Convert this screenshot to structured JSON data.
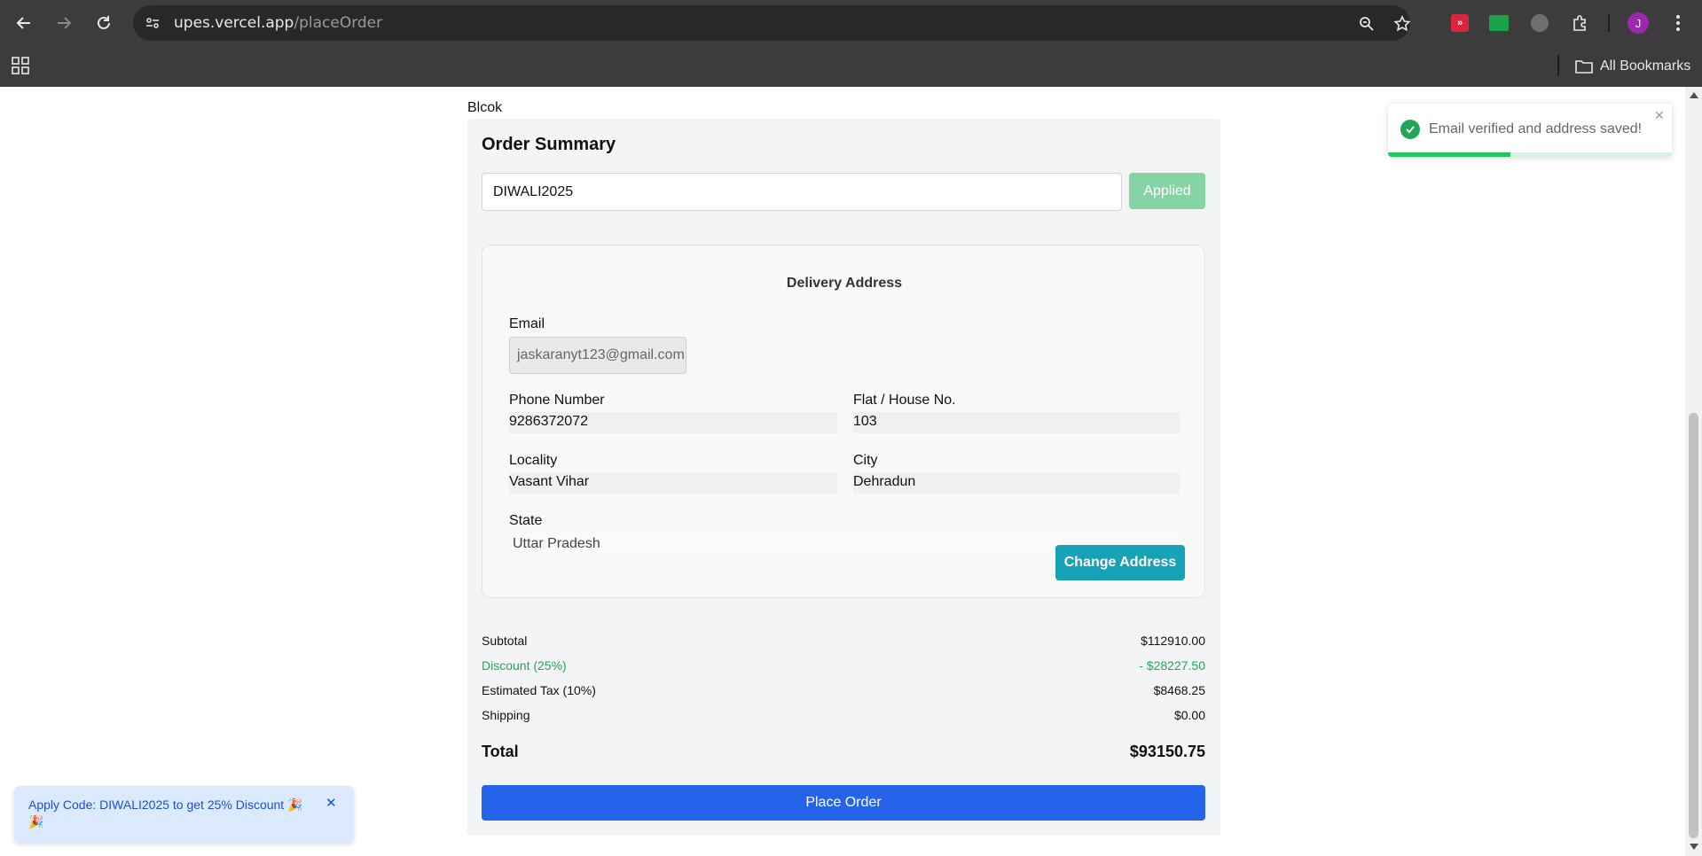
{
  "browser": {
    "url_host": "upes.vercel.app",
    "url_path": "/placeOrder",
    "profile_initial": "J",
    "all_bookmarks_label": "All Bookmarks"
  },
  "page": {
    "heading_small": "Blcok",
    "card_title": "Order Summary",
    "coupon": {
      "value": "DIWALI2025",
      "button_label": "Applied"
    },
    "address": {
      "title": "Delivery Address",
      "email_label": "Email",
      "email_value": "jaskaranyt123@gmail.com",
      "phone_label": "Phone Number",
      "phone_value": "9286372072",
      "flat_label": "Flat / House No.",
      "flat_value": "103",
      "locality_label": "Locality",
      "locality_value": "Vasant Vihar",
      "city_label": "City",
      "city_value": "Dehradun",
      "state_label": "State",
      "state_value": "Uttar Pradesh",
      "change_button": "Change Address"
    },
    "summary": {
      "subtotal_label": "Subtotal",
      "subtotal_value": "$112910.00",
      "discount_label": "Discount (25%)",
      "discount_value": "- $28227.50",
      "tax_label": "Estimated Tax (10%)",
      "tax_value": "$8468.25",
      "shipping_label": "Shipping",
      "shipping_value": "$0.00",
      "total_label": "Total",
      "total_value": "$93150.75"
    },
    "place_order_label": "Place Order"
  },
  "toast": {
    "message": "Email verified and address saved!",
    "progress": 0.43,
    "accent": "#22c55e"
  },
  "promo_toast": {
    "message": "Apply Code: DIWALI2025 to get 25% Discount 🎉🎉"
  },
  "colors": {
    "primary": "#2563eb",
    "teal": "#17a2b8",
    "success": "#22a559",
    "applied": "#86d3a6"
  }
}
